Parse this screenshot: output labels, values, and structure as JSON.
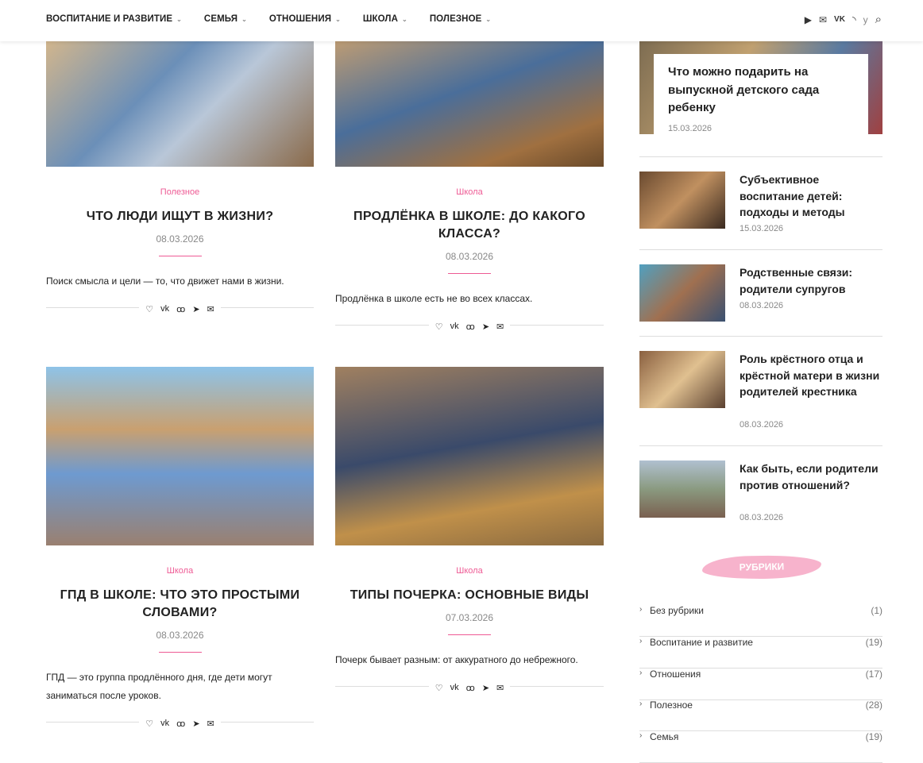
{
  "nav": {
    "items": [
      "ВОСПИТАНИЕ И РАЗВИТИЕ",
      "СЕМЬЯ",
      "ОТНОШЕНИЯ",
      "ШКОЛА",
      "ПОЛЕЗНОЕ"
    ]
  },
  "posts": [
    {
      "category": "Полезное",
      "title": "ЧТО ЛЮДИ ИЩУТ В ЖИЗНИ?",
      "date": "08.03.2026",
      "excerpt": "Поиск смысла и цели — то, что движет нами в жизни."
    },
    {
      "category": "Школа",
      "title": "ПРОДЛЁНКА В ШКОЛЕ: ДО КАКОГО КЛАССА?",
      "date": "08.03.2026",
      "excerpt": "Продлёнка в школе есть не во всех классах."
    },
    {
      "category": "Школа",
      "title": "ГПД В ШКОЛЕ: ЧТО ЭТО ПРОСТЫМИ СЛОВАМИ?",
      "date": "08.03.2026",
      "excerpt": "ГПД — это группа продлённого дня, где дети могут заниматься после уроков."
    },
    {
      "category": "Школа",
      "title": "ТИПЫ ПОЧЕРКА: ОСНОВНЫЕ ВИДЫ",
      "date": "07.03.2026",
      "excerpt": "Почерк бывает разным: от аккуратного до небрежного."
    }
  ],
  "sidebar": {
    "featured": {
      "title": "Что можно подарить на выпускной детского сада ребенку",
      "date": "15.03.2026"
    },
    "items": [
      {
        "title": "Субъективное воспитание детей: подходы и методы",
        "date": "15.03.2026"
      },
      {
        "title": "Родственные связи: родители супругов",
        "date": "08.03.2026"
      },
      {
        "title": "Роль крёстного отца и крёстной матери в жизни родителей крестника",
        "date": "08.03.2026"
      },
      {
        "title": "Как быть, если родители против отношений?",
        "date": "08.03.2026"
      }
    ],
    "rubrics_title": "РУБРИКИ",
    "rubrics": [
      {
        "name": "Без рубрики",
        "count": "(1)"
      },
      {
        "name": "Воспитание и развитие",
        "count": "(19)"
      },
      {
        "name": "Отношения",
        "count": "(17)"
      },
      {
        "name": "Полезное",
        "count": "(28)"
      },
      {
        "name": "Семья",
        "count": "(19)"
      }
    ]
  }
}
